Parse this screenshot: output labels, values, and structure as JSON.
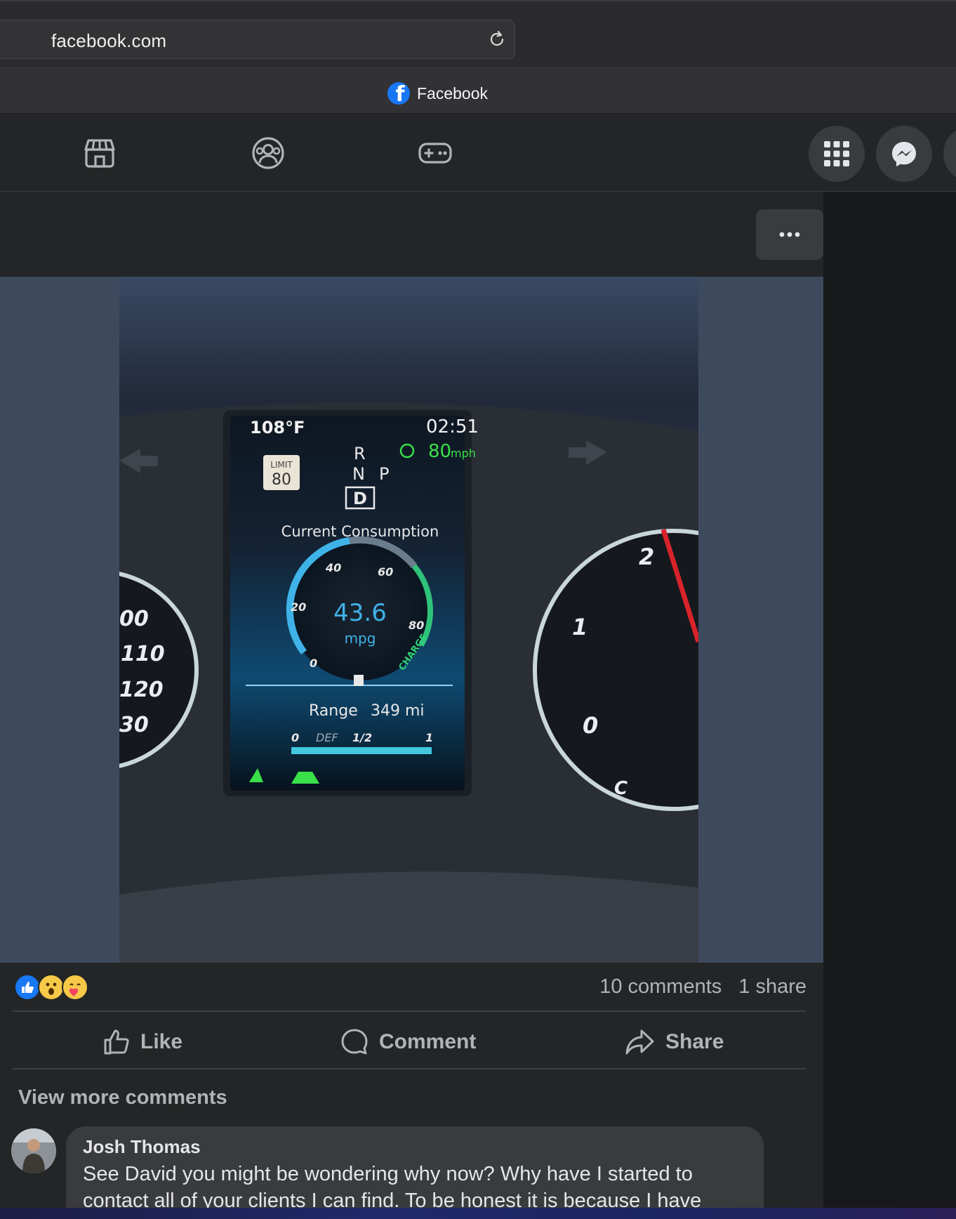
{
  "browser": {
    "url": "facebook.com",
    "tab_title": "Facebook"
  },
  "nav": {
    "icons": [
      "marketplace-icon",
      "groups-icon",
      "gaming-icon"
    ],
    "right_buttons": [
      "menu-grid-icon",
      "messenger-icon"
    ]
  },
  "post": {
    "more_label": "•••",
    "photo": {
      "temperature": "108°F",
      "clock": "02:51",
      "speed_limit_label": "LIMIT",
      "speed_limit_value": "80",
      "gear_r": "R",
      "gear_n": "N",
      "gear_p": "P",
      "gear_d": "D",
      "speed_value": "80",
      "speed_unit": "mph",
      "consumption_title": "Current Consumption",
      "gauge_ticks": [
        "0",
        "20",
        "40",
        "60",
        "80"
      ],
      "gauge_charge": "CHARGE",
      "mpg_value": "43.6",
      "mpg_unit": "mpg",
      "range_label": "Range",
      "range_value": "349 mi",
      "def_labels": [
        "0",
        "DEF",
        "1/2",
        "1"
      ],
      "left_dial_numbers": [
        "00",
        "110",
        "120",
        "30"
      ],
      "right_dial_numbers": [
        "2",
        "1",
        "0",
        "C"
      ]
    },
    "reactions": [
      "like",
      "wow",
      "care"
    ],
    "comment_count": "10 comments",
    "share_count": "1 share",
    "actions": {
      "like": "Like",
      "comment": "Comment",
      "share": "Share"
    },
    "view_more": "View more comments",
    "comment": {
      "author": "Josh Thomas",
      "text": "See David you might be wondering why now? Why have I started to contact all of your clients I can find. To be honest it is because I have"
    }
  },
  "colors": {
    "fb_blue": "#1877f2",
    "surface": "#242526",
    "gauge_blue": "#3fb3e8",
    "dash_green": "#39e04a"
  }
}
